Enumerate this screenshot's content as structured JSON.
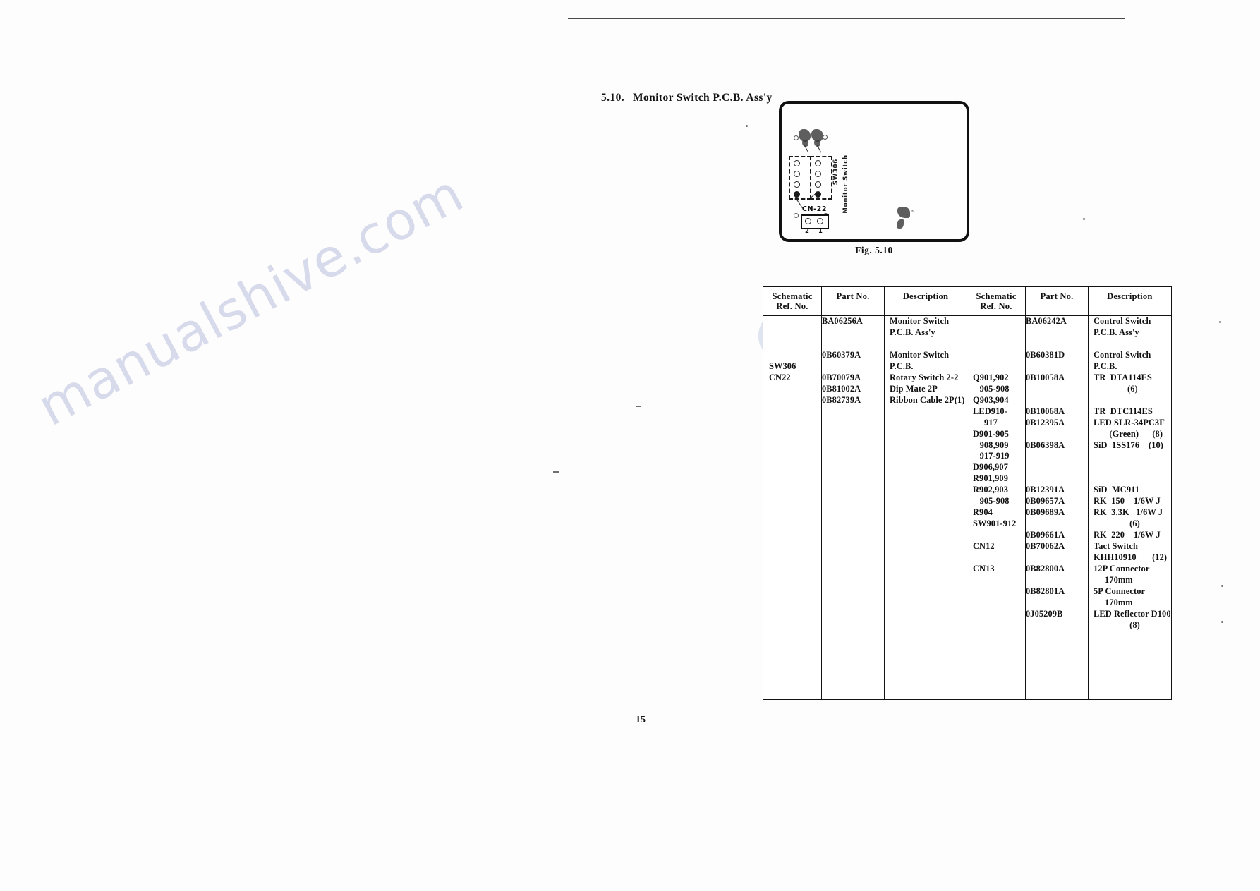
{
  "document": {
    "page_number": "15",
    "watermark": "manualshive.com"
  },
  "section": {
    "number": "5.10.",
    "title": "Monitor Switch P.C.B. Ass'y"
  },
  "figure": {
    "caption": "Fig. 5.10",
    "labels": {
      "switch_ref": "SW306",
      "switch_name": "Monitor Switch",
      "connector": "CN-22",
      "pin_2": "2",
      "pin_1": "1"
    }
  },
  "table": {
    "headers": [
      "Schematic\nRef. No.",
      "Part No.",
      "Description",
      "Schematic\nRef. No.",
      "Part No.",
      "Description"
    ],
    "left": {
      "schematic_ref": "\n\n\n\nSW306\nCN22",
      "part_no": "BA06256A\n\n\n0B60379A\n\n0B70079A\n0B81002A\n0B82739A",
      "description": "Monitor Switch\nP.C.B. Ass'y\n\nMonitor Switch\nP.C.B.\nRotary Switch 2-2\nDip Mate 2P\nRibbon Cable 2P(1)"
    },
    "right": {
      "schematic_ref": "\n\n\n\n\nQ901,902\n   905-908\nQ903,904\nLED910-\n     917\nD901-905\n   908,909\n   917-919\nD906,907\nR901,909\nR902,903\n   905-908\nR904\nSW901-912\n\nCN12\n\nCN13",
      "part_no": "BA06242A\n\n\n0B60381D\n\n0B10058A\n\n\n0B10068A\n0B12395A\n\n0B06398A\n\n\n\n0B12391A\n0B09657A\n0B09689A\n\n0B09661A\n0B70062A\n\n0B82800A\n\n0B82801A\n\n0J05209B",
      "description": "Control Switch\nP.C.B. Ass'y\n\nControl Switch\nP.C.B.\nTR  DTA114ES\n               (6)\n\nTR  DTC114ES\nLED SLR-34PC3F\n       (Green)      (8)\nSiD  1SS176    (10)\n\n\n\nSiD  MC911\nRK  150    1/6W J\nRK  3.3K   1/6W J\n                (6)\nRK  220    1/6W J\nTact Switch\nKHH10910       (12)\n12P Connector\n     170mm\n5P Connector\n     170mm\nLED Reflector D100\n                (8)"
    }
  }
}
